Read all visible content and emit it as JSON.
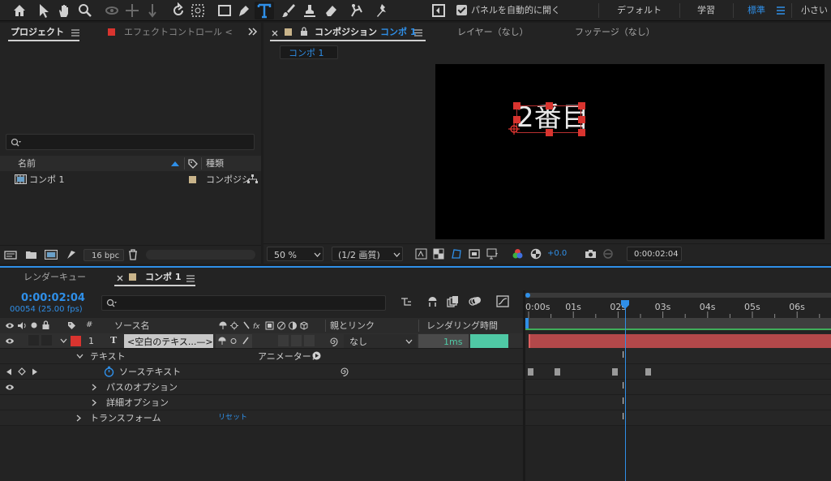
{
  "toolbar": {
    "auto_open_label": "パネルを自動的に開く",
    "workspaces": [
      "デフォルト",
      "学習",
      "標準",
      "小さい"
    ],
    "active_workspace": "標準"
  },
  "project": {
    "tab_label": "プロジェクト",
    "effect_tab_label": "エフェクトコントロール <",
    "search_placeholder": "",
    "col_name": "名前",
    "col_type": "種類",
    "items": [
      {
        "name": "コンポ 1",
        "type": "コンポジシ"
      }
    ],
    "bpc_label": "16 bpc"
  },
  "viewer": {
    "comp_tab_prefix": "コンポジション",
    "comp_tab_name": "コンポ 1",
    "layer_tab": "レイヤー（なし）",
    "footage_tab": "フッテージ（なし）",
    "sub_tab": "コンポ 1",
    "canvas_text": "2番目",
    "zoom": "50 %",
    "resolution": "(1/2 画質)",
    "exposure": "+0.0",
    "current_time": "0:00:02:04"
  },
  "timeline": {
    "render_queue_tab": "レンダーキュー",
    "comp_tab": "コンポ 1",
    "timecode": "0:00:02:04",
    "frame_info": "00054 (25.00 fps)",
    "search_placeholder": "",
    "col_num": "#",
    "col_source": "ソース名",
    "col_parent": "親とリンク",
    "col_render_time": "レンダリング時間",
    "layer": {
      "num": "1",
      "name": "<空白のテキス...—>",
      "parent": "なし",
      "render_time": "1ms"
    },
    "props": {
      "text": "テキスト",
      "animator": "アニメーター：",
      "source_text": "ソーステキスト",
      "path_options": "パスのオプション",
      "more_options": "詳細オプション",
      "transform": "トランスフォーム",
      "reset": "リセット"
    },
    "ruler": [
      "0:00s",
      "01s",
      "02s",
      "03s",
      "04s",
      "05s",
      "06s"
    ],
    "playhead_seconds": 2.16,
    "ruler_range_seconds": [
      0,
      6.5
    ]
  },
  "colors": {
    "accent": "#2f8fe8",
    "layer_label": "#d9342f",
    "layer_bar": "#b3484a",
    "render_bar": "#4fc9a5",
    "comp_swatch": "#c9b48a"
  }
}
